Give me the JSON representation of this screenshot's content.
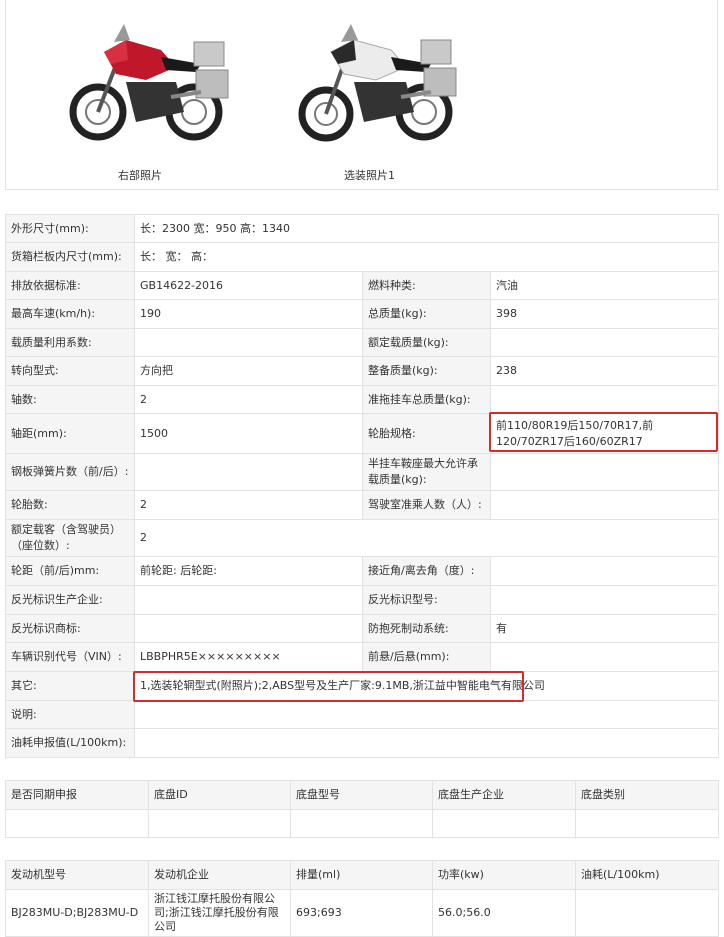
{
  "photos": [
    {
      "caption": "右部照片",
      "color": "#c0182a"
    },
    {
      "caption": "选装照片1",
      "color": "#eeeeee"
    }
  ],
  "spec_rows": [
    {
      "l1": "外形尺寸(mm):",
      "v1": "长：2300 宽：950 高：1340"
    },
    {
      "l1": "货箱栏板内尺寸(mm):",
      "v1": "长：  宽：  高："
    },
    {
      "l1": "排放依据标准:",
      "v1": "GB14622-2016",
      "l2": "燃料种类:",
      "v2": "汽油"
    },
    {
      "l1": "最高车速(km/h):",
      "v1": "190",
      "l2": "总质量(kg):",
      "v2": "398"
    },
    {
      "l1": "载质量利用系数:",
      "v1": "",
      "l2": "额定载质量(kg):",
      "v2": ""
    },
    {
      "l1": "转向型式:",
      "v1": "方向把",
      "l2": "整备质量(kg):",
      "v2": "238"
    },
    {
      "l1": "轴数:",
      "v1": "2",
      "l2": "准拖挂车总质量(kg):",
      "v2": ""
    },
    {
      "l1": "轴距(mm):",
      "v1": "1500",
      "l2": "轮胎规格:",
      "v2": "前110/80R19后150/70R17,前120/70ZR17后160/60ZR17"
    },
    {
      "l1": "钢板弹簧片数（前/后）:",
      "v1": "",
      "l2": "半挂车鞍座最大允许承载质量(kg):",
      "v2": ""
    },
    {
      "l1": "轮胎数:",
      "v1": "2",
      "l2": "驾驶室准乘人数（人）:",
      "v2": ""
    },
    {
      "l1": "额定载客（含驾驶员）（座位数）:",
      "v1": "2"
    },
    {
      "l1": "轮距（前/后)mm:",
      "v1": "前轮距: 后轮距:",
      "l2": "接近角/离去角（度）:",
      "v2": ""
    },
    {
      "l1": "反光标识生产企业:",
      "v1": "",
      "l2": "反光标识型号:",
      "v2": ""
    },
    {
      "l1": "反光标识商标:",
      "v1": "",
      "l2": "防抱死制动系统:",
      "v2": "有"
    },
    {
      "l1": "车辆识别代号（VIN）:",
      "v1": "LBBPHR5E×××××××××",
      "l2": "前悬/后悬(mm):",
      "v2": ""
    },
    {
      "l1": "其它:",
      "v1": "1,选装轮辋型式(附照片);2,ABS型号及生产厂家:9.1MB,浙江益中智能电气有限公司"
    },
    {
      "l1": "说明:",
      "v1": ""
    },
    {
      "l1": "油耗申报值(L/100km):",
      "v1": ""
    }
  ],
  "chassis_table": {
    "headers": [
      "是否同期申报",
      "底盘ID",
      "底盘型号",
      "底盘生产企业",
      "底盘类别"
    ],
    "row": [
      "",
      "",
      "",
      "",
      ""
    ]
  },
  "engine_table": {
    "headers": [
      "发动机型号",
      "发动机企业",
      "排量(ml)",
      "功率(kw)",
      "油耗(L/100km)"
    ],
    "row": [
      "BJ283MU-D;BJ283MU-D",
      "浙江钱江摩托股份有限公司;浙江钱江摩托股份有限公司",
      "693;693",
      "56.0;56.0",
      ""
    ]
  },
  "highlight_color": "#d42b2b"
}
